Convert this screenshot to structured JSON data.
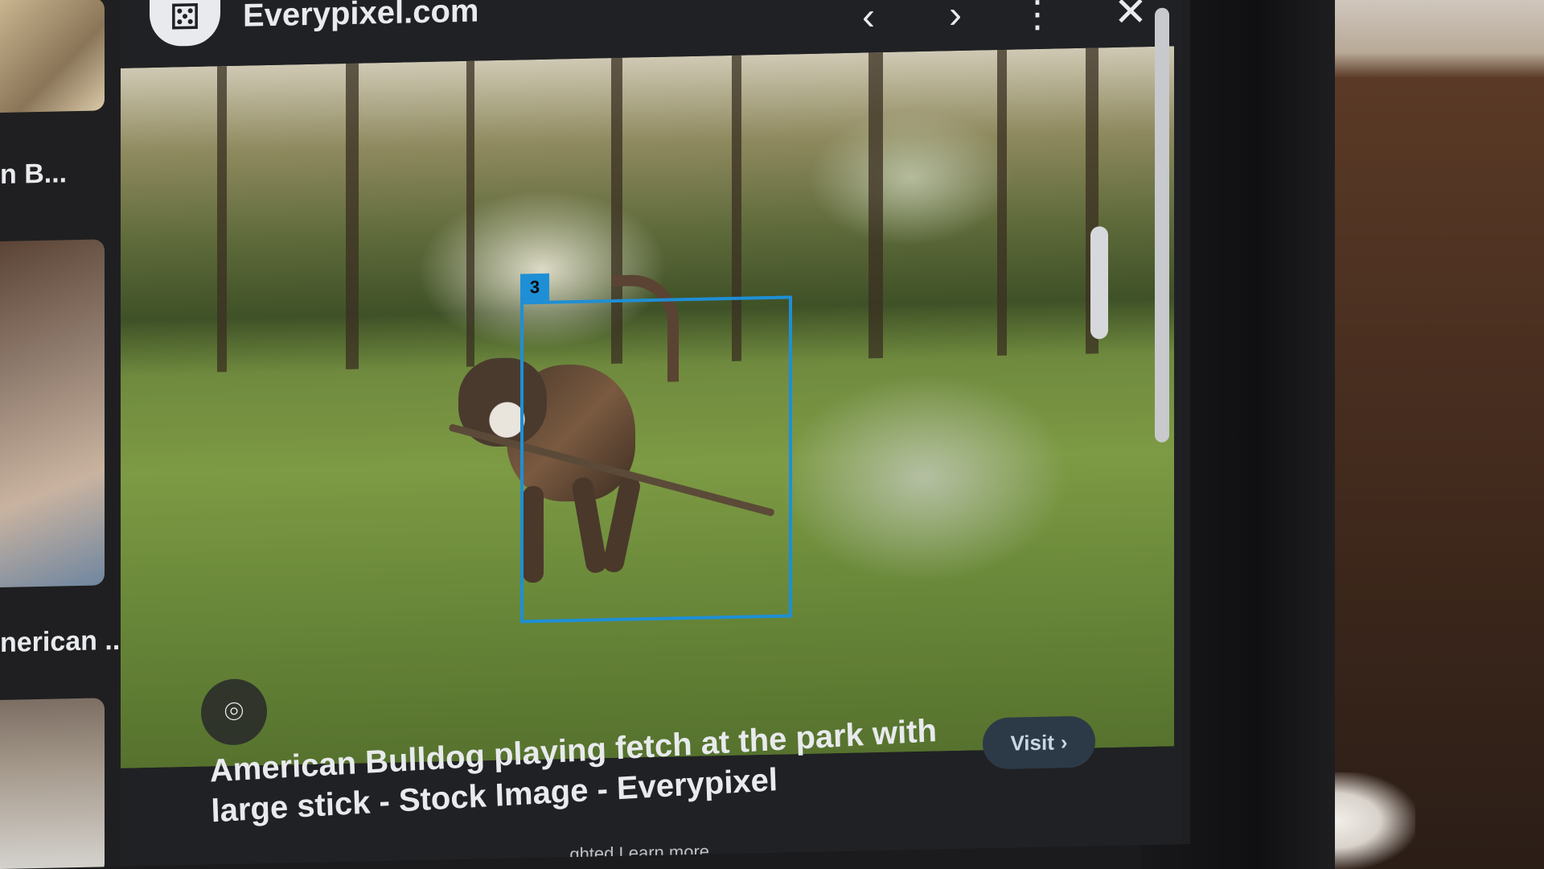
{
  "viewer": {
    "site_name": "Everypixel.com",
    "site_icon": "dice-logo-icon",
    "nav": {
      "prev_icon": "chevron-left-icon",
      "next_icon": "chevron-right-icon",
      "more_icon": "more-vert-icon",
      "close_icon": "close-icon"
    },
    "detection_tag": "3",
    "lens_icon": "lens-search-icon",
    "caption": "American Bulldog playing fetch at the park with large stick - Stock Image - Everypixel",
    "visit_label": "Visit",
    "license_text": "...ghted  Learn more"
  },
  "results_column": {
    "items": [
      {
        "label": ""
      },
      {
        "label": "n B..."
      },
      {
        "label": "nerican ..."
      }
    ]
  }
}
